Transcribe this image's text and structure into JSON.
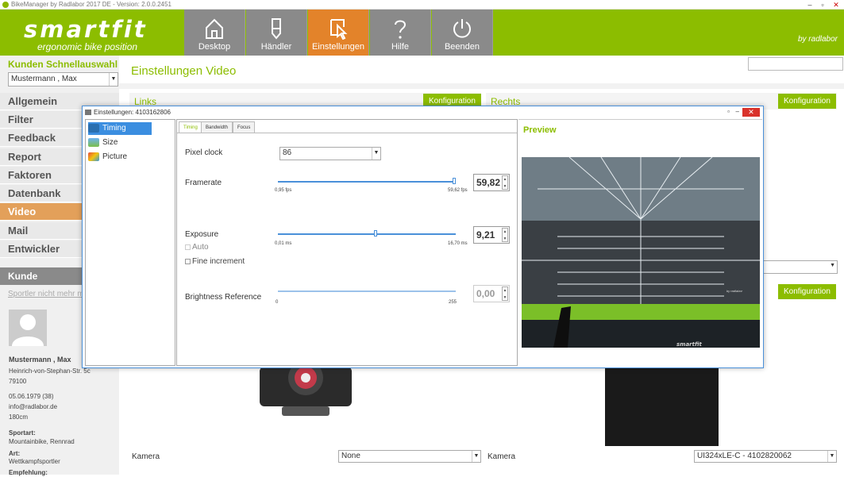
{
  "window": {
    "title": "BikeManager by Radlabor 2017 DE - Version: 2.0.0.2451",
    "minimize": "–",
    "maximize": "▫",
    "close": "✕"
  },
  "header": {
    "logo": {
      "brand": "smartfit",
      "tagline": "ergonomic bike position"
    },
    "nav": [
      {
        "label": "Desktop",
        "icon": "home-icon"
      },
      {
        "label": "Händler",
        "icon": "pen-icon"
      },
      {
        "label": "Einstellungen",
        "icon": "cursor-icon",
        "active": true
      },
      {
        "label": "Hilfe",
        "icon": "question-icon"
      },
      {
        "label": "Beenden",
        "icon": "power-icon"
      }
    ],
    "byline": "by radlabor"
  },
  "sidebar": {
    "quick_title": "Kunden Schnellauswahl",
    "selected_customer": "Mustermann , Max",
    "menu": [
      "Allgemein",
      "Filter",
      "Feedback",
      "Report",
      "Faktoren",
      "Datenbank",
      "Video",
      "Mail",
      "Entwickler"
    ],
    "active_item": "Video",
    "section_title": "Kunde",
    "sportler_link": "Sportler nicht mehr m",
    "customer": {
      "name": "Mustermann , Max",
      "street": "Heinrich-von-Stephan-Str. 5c",
      "zip": "79100",
      "birth": "05.06.1979 (38)",
      "email": "info@radlabor.de",
      "height": "180cm",
      "sportart_label": "Sportart:",
      "sportart": "Mountainbike, Rennrad",
      "art_label": "Art:",
      "art": "Wettkampfsportler",
      "empfehlung_label": "Empfehlung:"
    }
  },
  "main": {
    "title": "Einstellungen Video",
    "left_panel": {
      "title": "Links",
      "button": "Konfiguration",
      "camera_label": "Kamera",
      "camera_value": "None"
    },
    "right_panel": {
      "title": "Rechts",
      "button": "Konfiguration",
      "button2": "Konfiguration",
      "camera_label": "Kamera",
      "camera_value": "UI324xLE-C - 4102820062"
    }
  },
  "dialog": {
    "title": "Einstellungen: 4103162806",
    "tree": [
      "Timing",
      "Size",
      "Picture"
    ],
    "selected_tree": "Timing",
    "tabs": [
      "Timing",
      "Bandwidth",
      "Focus"
    ],
    "active_tab": "Timing",
    "pixel_clock": {
      "label": "Pixel clock",
      "value": "86"
    },
    "framerate": {
      "label": "Framerate",
      "min": "0,95 fps",
      "max": "59,62 fps",
      "value": "59,82",
      "fraction": 1.0
    },
    "exposure": {
      "label": "Exposure",
      "min": "0,01 ms",
      "max": "16,70 ms",
      "value": "9,21",
      "fraction": 0.55,
      "auto": "Auto",
      "fine": "Fine increment"
    },
    "brightness": {
      "label": "Brightness Reference",
      "min": "0",
      "max": "255",
      "value": "0,00"
    },
    "preview_title": "Preview",
    "preview_logo": "smartfit",
    "preview_watermark": "by radlabor"
  },
  "colors": {
    "brand_green": "#8cbd00",
    "active_orange": "#e3832a",
    "nav_gray": "#8a8a8a"
  }
}
